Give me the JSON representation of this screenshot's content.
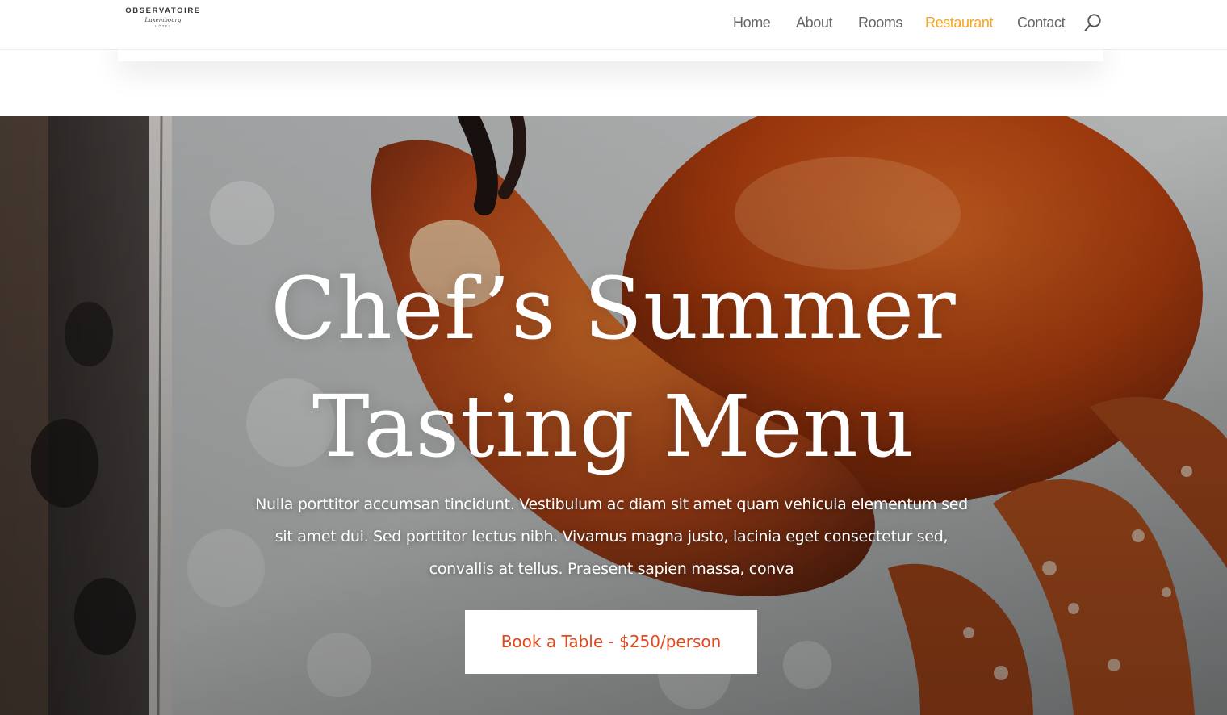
{
  "brand": {
    "name": "OBSERVATOIRE",
    "script": "Luxembourg",
    "sub": "HÔTEL"
  },
  "nav": {
    "items": [
      {
        "label": "Home"
      },
      {
        "label": "About"
      },
      {
        "label": "Rooms"
      },
      {
        "label": "Restaurant",
        "active": true
      },
      {
        "label": "Contact"
      }
    ],
    "search_icon": "search-icon"
  },
  "hero": {
    "title_line1": "Chef’s Summer",
    "title_line2": "Tasting Menu",
    "text": "Nulla porttitor accumsan tincidunt. Vestibulum ac diam sit amet quam vehicula elementum sed sit amet dui. Sed porttitor lectus nibh. Vivamus magna justo, lacinia eget consectetur sed, convallis at tellus. Praesent sapien massa, conva",
    "cta_label": "Book a Table - $250/person",
    "background": "crab-on-ice-photo"
  },
  "colors": {
    "accent": "#f5a623",
    "cta_text": "#e0491b",
    "nav_text": "#666666"
  }
}
